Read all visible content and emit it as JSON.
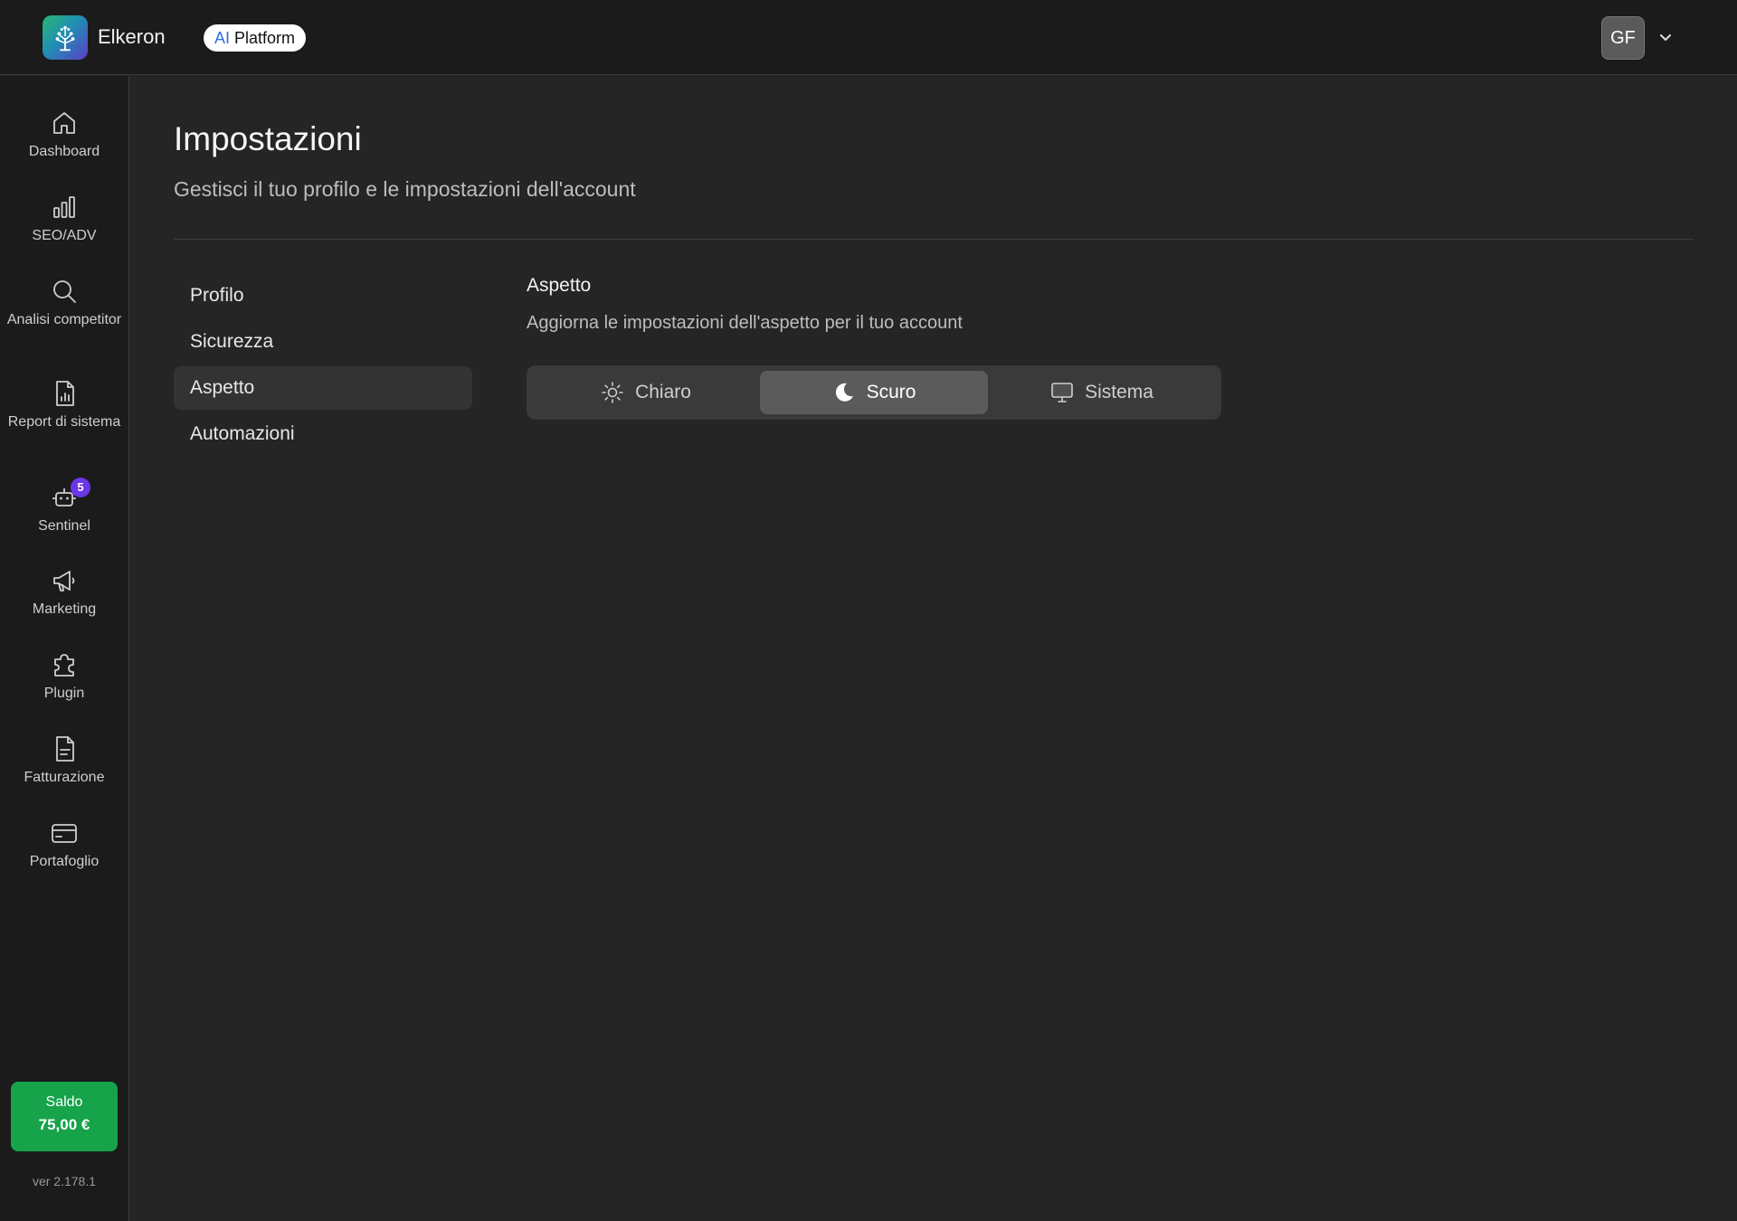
{
  "header": {
    "brand": "Elkeron",
    "pill_ai": "AI",
    "pill_label": "Platform",
    "avatar_initials": "GF"
  },
  "sidebar": {
    "items": [
      {
        "label": "Dashboard",
        "icon": "home-icon"
      },
      {
        "label": "SEO/ADV",
        "icon": "bar-chart-icon"
      },
      {
        "label": "Analisi competitor",
        "icon": "search-icon"
      },
      {
        "label": "Report di sistema",
        "icon": "file-chart-icon"
      },
      {
        "label": "Sentinel",
        "icon": "robot-icon",
        "badge": "5"
      },
      {
        "label": "Marketing",
        "icon": "megaphone-icon"
      },
      {
        "label": "Plugin",
        "icon": "puzzle-icon"
      },
      {
        "label": "Fatturazione",
        "icon": "document-icon"
      },
      {
        "label": "Portafoglio",
        "icon": "credit-card-icon"
      }
    ],
    "balance_label": "Saldo",
    "balance_value": "75,00 €",
    "version": "ver 2.178.1"
  },
  "page": {
    "title": "Impostazioni",
    "subtitle": "Gestisci il tuo profilo e le impostazioni dell'account"
  },
  "settings_nav": {
    "items": [
      "Profilo",
      "Sicurezza",
      "Aspetto",
      "Automazioni"
    ],
    "active": "Aspetto"
  },
  "appearance": {
    "title": "Aspetto",
    "subtitle": "Aggiorna le impostazioni dell'aspetto per il tuo account",
    "options": [
      {
        "label": "Chiaro",
        "icon": "sun-icon"
      },
      {
        "label": "Scuro",
        "icon": "moon-icon"
      },
      {
        "label": "Sistema",
        "icon": "monitor-icon"
      }
    ],
    "selected": "Scuro"
  },
  "colors": {
    "background": "#252525",
    "topbar": "#1b1b1b",
    "balance_green": "#16a34a",
    "badge_purple": "#6b35e8",
    "pill_ai_blue": "#2e6fe0"
  }
}
